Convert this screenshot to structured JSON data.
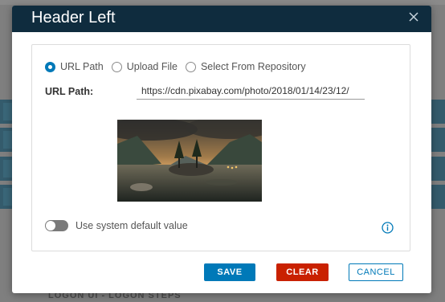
{
  "background": {
    "footer_text": "LOGON UI - LOGON STEPS"
  },
  "dialog": {
    "title": "Header Left",
    "close_icon": "close-icon",
    "image_source_options": [
      {
        "label": "URL Path",
        "selected": true
      },
      {
        "label": "Upload File",
        "selected": false
      },
      {
        "label": "Select From Repository",
        "selected": false
      }
    ],
    "url_field": {
      "label": "URL Path:",
      "value": "https://cdn.pixabay.com/photo/2018/01/14/23/12/"
    },
    "preview_image": "mountain-lake-landscape-image",
    "default_toggle": {
      "label": "Use system default value",
      "on": false
    },
    "info_icon": "info-icon",
    "buttons": {
      "save": "SAVE",
      "clear": "CLEAR",
      "cancel": "CANCEL"
    },
    "colors": {
      "header_bg": "#0f2c3e",
      "primary": "#0079b8",
      "danger": "#c92100"
    }
  }
}
